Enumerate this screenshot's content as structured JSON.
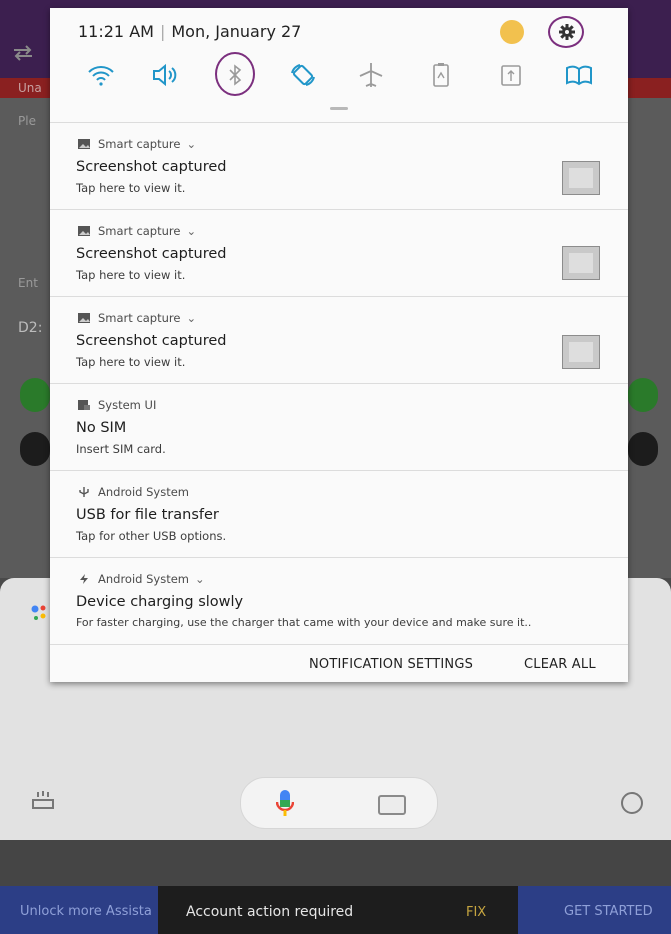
{
  "status_bar": {
    "time": "11:21 AM",
    "date": "Mon, January 27"
  },
  "quick_settings": [
    "wifi-icon",
    "sound-icon",
    "bluetooth-icon",
    "auto-rotate-icon",
    "airplane-mode-icon",
    "power-saving-icon",
    "mobile-data-icon",
    "book-icon"
  ],
  "notifications": [
    {
      "app": "Smart capture",
      "title": "Screenshot captured",
      "text": "Tap here to view it."
    },
    {
      "app": "Smart capture",
      "title": "Screenshot captured",
      "text": "Tap here to view it."
    },
    {
      "app": "Smart capture",
      "title": "Screenshot captured",
      "text": "Tap here to view it."
    },
    {
      "app": "System UI",
      "title": "No SIM",
      "text": "Insert SIM card."
    },
    {
      "app": "Android System",
      "title": "USB for file transfer",
      "text": "Tap for other USB options."
    },
    {
      "app": "Android System",
      "title": "Device charging slowly",
      "text": "For faster charging, use the charger that came with your device and make sure it.."
    }
  ],
  "actions": {
    "settings": "NOTIFICATION SETTINGS",
    "clear": "CLEAR ALL"
  },
  "background": {
    "banner_left": "Una",
    "label_1": "Ple",
    "label_2": "Ent",
    "input_value": "D2:",
    "bottom_left": "Unlock more Assista",
    "toast": "Account action required",
    "toast_action": "FIX",
    "get_started": "GET STARTED"
  },
  "colors": {
    "accent_circle": "#7b2f7e",
    "tile_blue": "#2196c9",
    "green_button": "#2e8b2e",
    "brand_bar": "#2c3e86"
  }
}
